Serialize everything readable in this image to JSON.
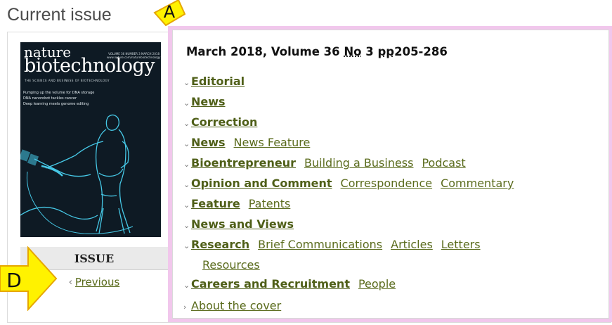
{
  "page": {
    "heading": "Current issue"
  },
  "cover": {
    "masthead_line1": "nature",
    "masthead_line2": "biotechnology",
    "top_meta_1": "VOLUME 36 NUMBER 3 MARCH 2018",
    "top_meta_2": "www.nature.com/naturebiotechnology",
    "tagline": "THE SCIENCE AND BUSINESS OF BIOTECHNOLOGY",
    "lines": [
      "Pumping up the volume for DNA storage",
      "DNA nanorobot tackles cancer",
      "Deep learning meets genome editing"
    ]
  },
  "issue_nav": {
    "title": "ISSUE",
    "previous_label": "Previous"
  },
  "toc": {
    "issue_date_volume": "March 2018, Volume 36 ",
    "number_abbr": "No",
    "number_value": " 3 ",
    "pages_abbr": "pp",
    "pages_value": "205-286",
    "sections": [
      {
        "label": "Editorial",
        "subs": []
      },
      {
        "label": "News",
        "subs": []
      },
      {
        "label": "Correction",
        "subs": []
      },
      {
        "label": "News",
        "subs": [
          "News Feature"
        ]
      },
      {
        "label": "Bioentrepreneur",
        "subs": [
          "Building a Business",
          "Podcast"
        ]
      },
      {
        "label": "Opinion and Comment",
        "subs": [
          "Correspondence",
          "Commentary"
        ]
      },
      {
        "label": "Feature",
        "subs": [
          "Patents"
        ]
      },
      {
        "label": "News and Views",
        "subs": []
      },
      {
        "label": "Research",
        "subs": [
          "Brief Communications",
          "Articles",
          "Letters"
        ],
        "continuation": [
          "Resources"
        ]
      },
      {
        "label": "Careers and Recruitment",
        "subs": [
          "People"
        ]
      }
    ],
    "about_cover": "About the cover"
  },
  "annotations": {
    "label_a": "A",
    "label_d": "D",
    "color_fill": "#fff200",
    "color_stroke": "#e6a700"
  },
  "colors": {
    "link": "#5a6b1c",
    "highlight_border": "#f1c7ec",
    "cover_bg": "#0e1a24"
  }
}
